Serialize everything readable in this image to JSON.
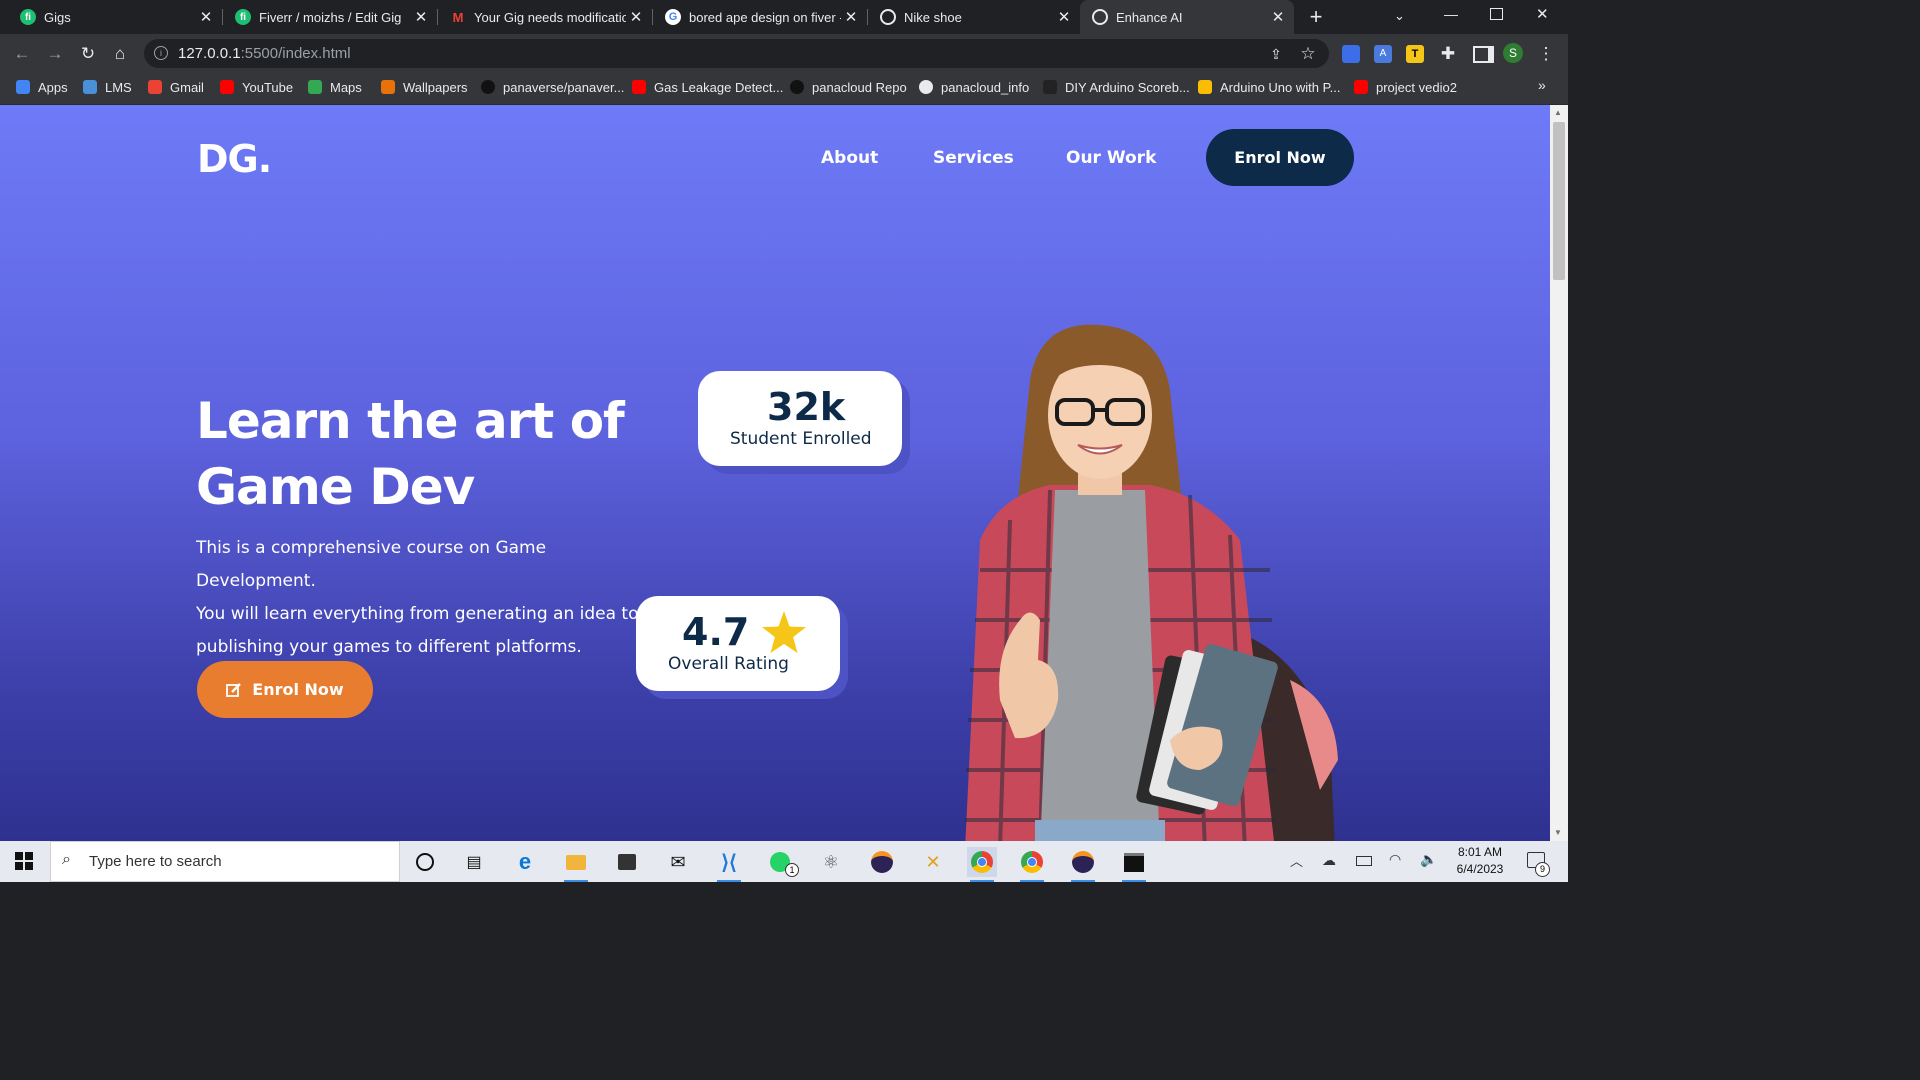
{
  "browser": {
    "tabs": [
      {
        "title": "Gigs",
        "favicon": "fiverr-icon",
        "color": "#1dbf73"
      },
      {
        "title": "Fiverr / moizhs / Edit Gig",
        "favicon": "fiverr-icon",
        "color": "#1dbf73"
      },
      {
        "title": "Your Gig needs modification",
        "favicon": "gmail-icon",
        "color": "#ea4335"
      },
      {
        "title": "bored ape design on fiver -",
        "favicon": "google-icon",
        "color": "#4285f4"
      },
      {
        "title": "Nike shoe",
        "favicon": "globe-icon",
        "color": "#9aa0a6"
      },
      {
        "title": "Enhance AI",
        "favicon": "globe-icon",
        "color": "#9aa0a6",
        "active": true
      }
    ],
    "url_host": "127.0.0.1",
    "url_rest": ":5500/index.html",
    "profile_initial": "S",
    "bookmarks": [
      {
        "label": "Apps",
        "icon": "apps-grid-icon",
        "color": "#4285f4"
      },
      {
        "label": "LMS",
        "icon": "lms-icon",
        "color": "#4a90d9"
      },
      {
        "label": "Gmail",
        "icon": "gmail-icon",
        "color": "#ea4335"
      },
      {
        "label": "YouTube",
        "icon": "youtube-icon",
        "color": "#ff0000"
      },
      {
        "label": "Maps",
        "icon": "maps-icon",
        "color": "#34a853"
      },
      {
        "label": "Wallpapers",
        "icon": "flame-icon",
        "color": "#e8710a"
      },
      {
        "label": "panaverse/panaver...",
        "icon": "github-icon",
        "color": "#111111"
      },
      {
        "label": "Gas Leakage Detect...",
        "icon": "youtube-icon",
        "color": "#ff0000"
      },
      {
        "label": "panacloud Repo",
        "icon": "github-icon",
        "color": "#111111"
      },
      {
        "label": "panacloud_info",
        "icon": "globe-icon",
        "color": "#e8eaed"
      },
      {
        "label": "DIY Arduino Scoreb...",
        "icon": "chip-icon",
        "color": "#222222"
      },
      {
        "label": "Arduino Uno with P...",
        "icon": "drive-icon",
        "color": "#fbbc04"
      },
      {
        "label": "project vedio2",
        "icon": "youtube-icon",
        "color": "#ff0000"
      }
    ]
  },
  "site": {
    "logo": "DG.",
    "nav": [
      "About",
      "Services",
      "Our Work"
    ],
    "cta_top": "Enrol Now",
    "hero_title_line1": "Learn the art of",
    "hero_title_line2": "Game Dev",
    "hero_text_line1": "This is a comprehensive course on Game Development.",
    "hero_text_line2": "You will learn everything from generating an idea to",
    "hero_text_line3": "publishing your games to different platforms.",
    "cta_hero": "Enrol Now",
    "stat_enrolled_value": "32k",
    "stat_enrolled_label": "Student Enrolled",
    "stat_rating_value": "4.7",
    "stat_rating_label": "Overall Rating",
    "colors": {
      "navy": "#0d2a48",
      "orange": "#e97d2f",
      "star": "#f5c518",
      "bg_top": "#6e7af7",
      "bg_bottom": "#2f3190"
    }
  },
  "taskbar": {
    "search_placeholder": "Type here to search",
    "whatsapp_badge": "1",
    "time": "8:01 AM",
    "date": "6/4/2023",
    "notification_count": "9"
  }
}
